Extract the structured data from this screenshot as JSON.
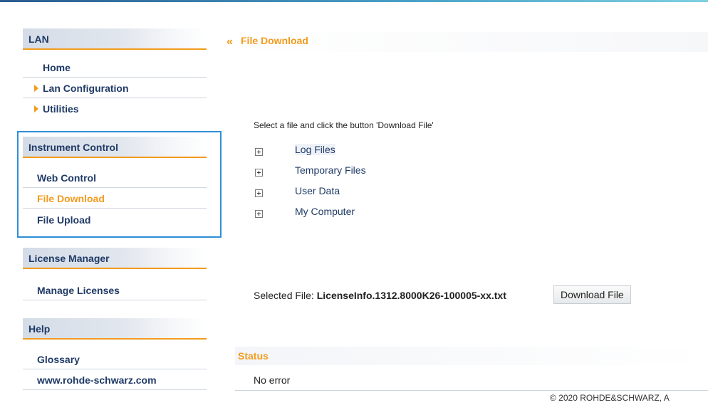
{
  "sidebar": {
    "lan": {
      "header": "LAN",
      "items": [
        {
          "label": "Home",
          "arrow": false
        },
        {
          "label": "Lan Configuration",
          "arrow": true
        },
        {
          "label": "Utilities",
          "arrow": true
        }
      ]
    },
    "instrument_control": {
      "header": "Instrument Control",
      "items": [
        {
          "label": "Web Control",
          "active": false
        },
        {
          "label": "File Download",
          "active": true
        },
        {
          "label": "File Upload",
          "active": false
        }
      ]
    },
    "license_manager": {
      "header": "License Manager",
      "items": [
        {
          "label": "Manage Licenses"
        }
      ]
    },
    "help": {
      "header": "Help",
      "items": [
        {
          "label": "Glossary"
        },
        {
          "label": "www.rohde-schwarz.com"
        }
      ]
    }
  },
  "main": {
    "breadcrumb_icon": "«",
    "breadcrumb": "File Download",
    "instruction": "Select a file and click the button 'Download File'",
    "tree": [
      {
        "label": "Log Files"
      },
      {
        "label": "Temporary Files"
      },
      {
        "label": "User Data"
      },
      {
        "label": "My Computer"
      }
    ],
    "selected_label": "Selected File:",
    "selected_file": "LicenseInfo.1312.8000K26-100005-xx.txt",
    "download_button": "Download File",
    "status_header": "Status",
    "status_text": "No error",
    "copyright": "© 2020 ROHDE&SCHWARZ, A"
  },
  "colors": {
    "accent": "#f29b1e",
    "nav_text": "#1f3a66",
    "highlight_border": "#2e8fd6"
  }
}
